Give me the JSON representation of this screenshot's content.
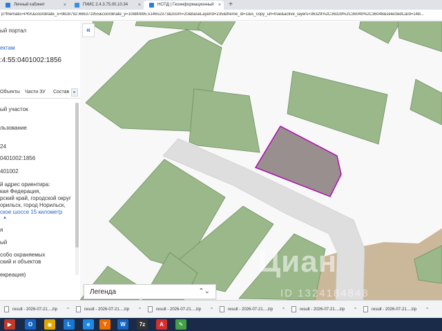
{
  "browser": {
    "tabs": [
      {
        "label": "Личный кабинет",
        "favicon_color": "#2e7bd6",
        "active": false
      },
      {
        "label": "ГМИС 2.4.3.75.00.10.34",
        "favicon_color": "#3a8ee6",
        "active": false
      },
      {
        "label": "НСПД | Геоинформационный",
        "favicon_color": "#2e7bd6",
        "active": true
      }
    ],
    "close_glyph": "×",
    "new_tab_glyph": "+",
    "url": "p?thematic=PKK&coordinate_x=9828792.666371955&coordinate_y=10880895.514652373&zoom=20&baseLayerId=235&theme_id=1&is_copy_url=true&active_layers=36329%2C36328%2C36049%2C36048&selectedCard=14B..."
  },
  "left_panel": {
    "portal_label": "ый портал",
    "objects_link": "ектам",
    "cadastral_number": ":4:55:0401002:1856",
    "subtabs": [
      "Объекты",
      "Части ЗУ",
      "Состав"
    ],
    "subtab_arrow": "▸",
    "lines": [
      "ый участок",
      "льзование",
      "24",
      "0401002:1856",
      "401002",
      "й адрес ориентира:",
      "кая Федерация,",
      "рский край, городской округ",
      "орильск, город Норильск,",
      "ское шоссе 15 километр",
      "▲",
      "я",
      "ый",
      "собо охраняемых",
      "ский и объектов",
      "екреация)"
    ]
  },
  "map": {
    "collapse_glyph": "«",
    "legend_label": "Легенда",
    "legend_chevron": "⌃⌄",
    "watermark": "Циан",
    "watermark_id": "ID 1324184848",
    "colors": {
      "parcel_green": "#9ab88a",
      "parcel_stroke": "#6f8f62",
      "selected_fill": "#9a8f8f",
      "selected_stroke": "#b000b0",
      "road": "#dedede",
      "brown_area": "#cbb89a",
      "background": "#f8f8f8"
    }
  },
  "downloads": {
    "items": [
      "result - 2026-07-21....zip",
      "result - 2026-07-21....zip",
      "result - 2026-07-21....zip",
      "result - 2026-07-21....zip",
      "result - 2026-07-21....zip",
      "result - 2026-07-21....zip"
    ],
    "caret": "^"
  },
  "taskbar": {
    "icons": [
      {
        "name": "start-icon",
        "glyph": "▶",
        "color": "#c0392b"
      },
      {
        "name": "outlook-icon",
        "glyph": "O",
        "color": "#1565c0"
      },
      {
        "name": "chrome-icon",
        "glyph": "◉",
        "color": "#e0a800"
      },
      {
        "name": "lync-icon",
        "glyph": "L",
        "color": "#1976d2"
      },
      {
        "name": "ie-icon",
        "glyph": "e",
        "color": "#1e88e5"
      },
      {
        "name": "yandex-icon",
        "glyph": "Y",
        "color": "#ef6c00"
      },
      {
        "name": "word-icon",
        "glyph": "W",
        "color": "#1565c0"
      },
      {
        "name": "7zip-icon",
        "glyph": "7z",
        "color": "#333333"
      },
      {
        "name": "acrobat-icon",
        "glyph": "A",
        "color": "#d32f2f"
      },
      {
        "name": "paint-icon",
        "glyph": "✎",
        "color": "#43a047"
      }
    ]
  }
}
